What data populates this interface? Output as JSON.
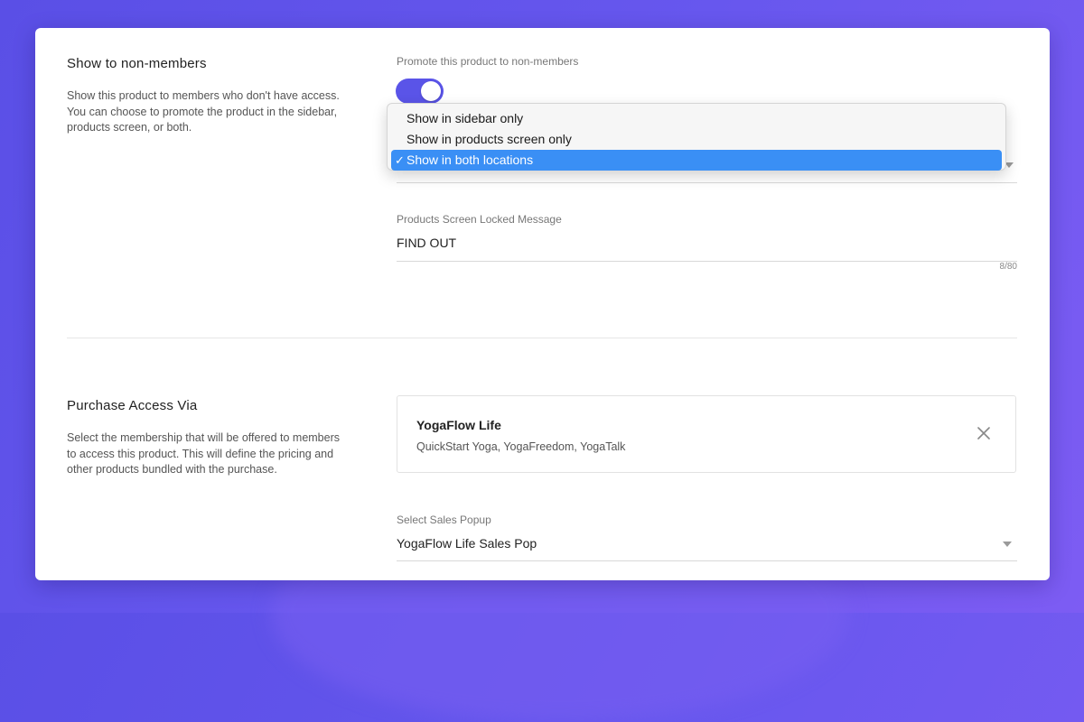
{
  "show_to_non_members": {
    "title": "Show to non-members",
    "description": "Show this product to members who don't have access. You can choose to promote the product in the sidebar, products screen, or both.",
    "toggle_label": "Promote this product to non-members",
    "toggle_on": true,
    "location_dropdown": {
      "options": [
        {
          "label": "Show in sidebar only",
          "selected": false
        },
        {
          "label": "Show in products screen only",
          "selected": false
        },
        {
          "label": "Show in both locations",
          "selected": true
        }
      ],
      "check_glyph": "✓"
    },
    "locked_message": {
      "label": "Products Screen Locked Message",
      "value": "FIND OUT",
      "counter": "8/80"
    }
  },
  "purchase_access": {
    "title": "Purchase Access Via",
    "description": "Select the membership that will be offered to members to access this product. This will define the pricing and other products bundled with the purchase.",
    "membership": {
      "name": "YogaFlow Life",
      "products": "QuickStart Yoga, YogaFreedom, YogaTalk"
    },
    "sales_popup": {
      "label": "Select Sales Popup",
      "value": "YogaFlow Life Sales Pop"
    }
  },
  "colors": {
    "accent": "#5a54e8",
    "selected_option": "#3a8ff5",
    "background": "#6757ee"
  },
  "icons": {
    "close": "close-icon",
    "dropdown": "chevron-down-icon",
    "check": "check-icon"
  }
}
